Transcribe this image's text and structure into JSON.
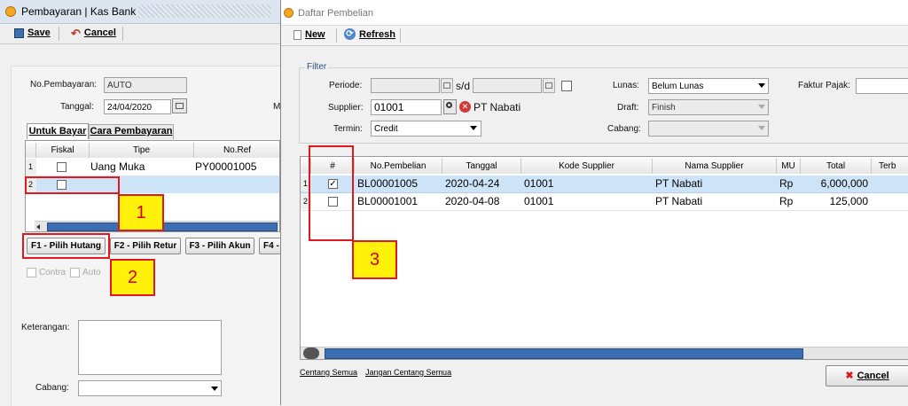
{
  "left_window": {
    "title": "Pembayaran | Kas Bank",
    "toolbar": {
      "save_label": "Save",
      "cancel_label": "Cancel"
    },
    "no_pembayaran_label": "No.Pembayaran:",
    "no_pembayaran_value": "AUTO",
    "tanggal_label": "Tanggal:",
    "tanggal_value": "24/04/2020",
    "cutoff_label": "M",
    "tabs": [
      {
        "label": "Untuk Bayar"
      },
      {
        "label": "Cara Pembayaran"
      }
    ],
    "grid": {
      "headers": [
        "Fiskal",
        "Tipe",
        "No.Ref"
      ],
      "rows": [
        {
          "num": "1",
          "fiskal": false,
          "tipe": "Uang Muka",
          "noref": "PY00001005"
        },
        {
          "num": "2",
          "fiskal": false,
          "tipe": "",
          "noref": ""
        }
      ]
    },
    "buttons": {
      "f1": "F1 - Pilih Hutang",
      "f2": "F2 - Pilih Retur",
      "f3": "F3 - Pilih Akun",
      "f4": "F4 -"
    },
    "contra_label": "Contra",
    "auto_label": "Auto",
    "keterangan_label": "Keterangan:",
    "cabang_label": "Cabang:"
  },
  "right_window": {
    "title": "Daftar Pembelian",
    "toolbar": {
      "new_label": "New",
      "refresh_label": "Refresh"
    },
    "filter": {
      "legend": "Filter",
      "periode_label": "Periode:",
      "sd_label": "s/d",
      "supplier_label": "Supplier:",
      "supplier_code": "01001",
      "supplier_name": "PT Nabati",
      "termin_label": "Termin:",
      "termin_value": "Credit",
      "lunas_label": "Lunas:",
      "lunas_value": "Belum Lunas",
      "draft_label": "Draft:",
      "draft_value": "Finish",
      "cabang_label": "Cabang:",
      "faktur_label": "Faktur Pajak:"
    },
    "grid": {
      "headers": [
        "#",
        "No.Pembelian",
        "Tanggal",
        "Kode Supplier",
        "Nama Supplier",
        "MU",
        "Total",
        "Terb"
      ],
      "rows": [
        {
          "num": "1",
          "checked": true,
          "no": "BL00001005",
          "tanggal": "2020-04-24",
          "kode": "01001",
          "nama": "PT Nabati",
          "mu": "Rp",
          "total": "6,000,000"
        },
        {
          "num": "2",
          "checked": false,
          "no": "BL00001001",
          "tanggal": "2020-04-08",
          "kode": "01001",
          "nama": "PT Nabati",
          "mu": "Rp",
          "total": "125,000"
        }
      ]
    },
    "links": {
      "centang_semua": "Centang Semua",
      "jangan_centang": "Jangan Centang Semua"
    },
    "cancel_label": "Cancel"
  },
  "callouts": [
    "1",
    "2",
    "3"
  ],
  "colors": {
    "highlight": "#e0191f",
    "callout_fill": "#fff10a",
    "selected_row": "#cde3f7"
  }
}
